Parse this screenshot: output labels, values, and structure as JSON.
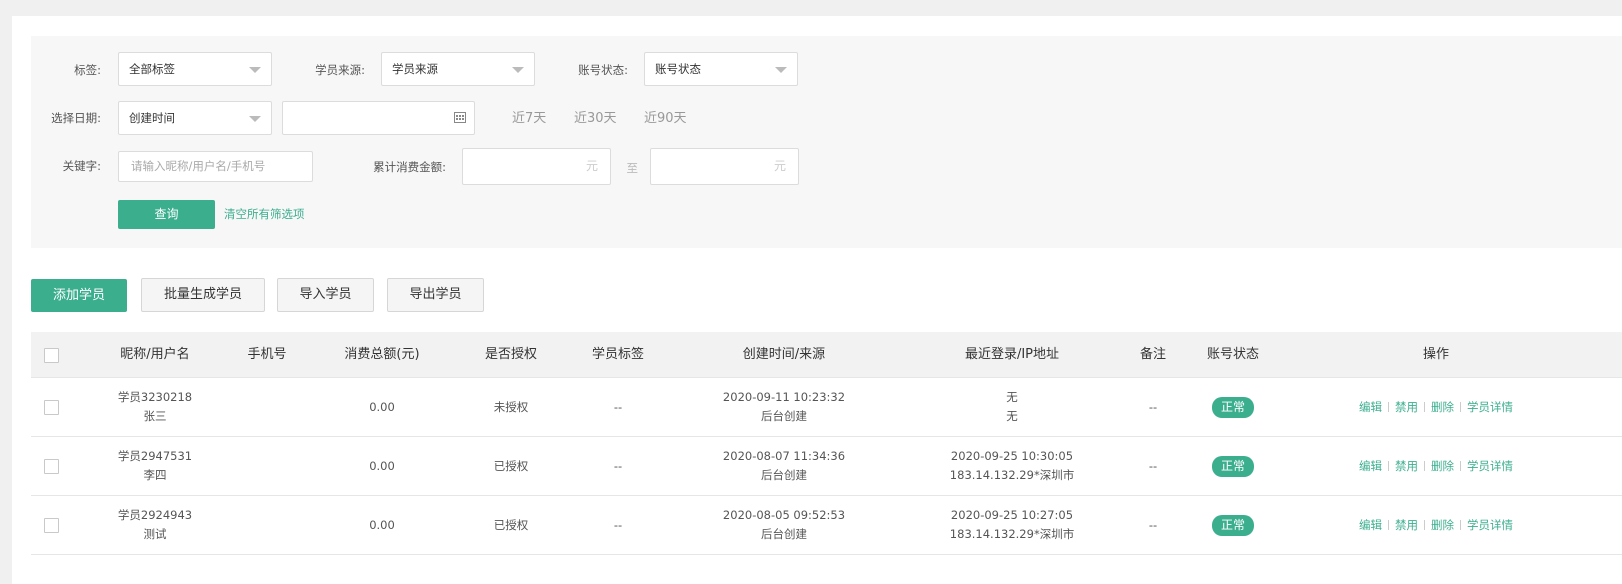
{
  "filters": {
    "tag_label": "标签:",
    "tag_value": "全部标签",
    "source_label": "学员来源:",
    "source_value": "学员来源",
    "status_label": "账号状态:",
    "status_value": "账号状态",
    "date_label": "选择日期:",
    "date_type_value": "创建时间",
    "quick_7": "近7天",
    "quick_30": "近30天",
    "quick_90": "近90天",
    "keyword_label": "关键字:",
    "keyword_placeholder": "请输入昵称/用户名/手机号",
    "amount_label": "累计消费金额:",
    "amount_unit": "元",
    "amount_to": "至",
    "query_button": "查询",
    "clear_link": "清空所有筛选项"
  },
  "actions": {
    "add": "添加学员",
    "batch": "批量生成学员",
    "import": "导入学员",
    "export": "导出学员"
  },
  "table": {
    "headers": {
      "name": "昵称/用户名",
      "phone": "手机号",
      "amount": "消费总额(元)",
      "auth": "是否授权",
      "tag": "学员标签",
      "created": "创建时间/来源",
      "login": "最近登录/IP地址",
      "remark": "备注",
      "status": "账号状态",
      "ops": "操作"
    },
    "rows": [
      {
        "nickname": "学员3230218",
        "username": "张三",
        "phone": "",
        "amount": "0.00",
        "auth": "未授权",
        "tag": "--",
        "created_time": "2020-09-11 10:23:32",
        "created_source": "后台创建",
        "login_time": "无",
        "login_ip": "无",
        "remark": "--",
        "status": "正常"
      },
      {
        "nickname": "学员2947531",
        "username": "李四",
        "phone": "",
        "amount": "0.00",
        "auth": "已授权",
        "tag": "--",
        "created_time": "2020-08-07 11:34:36",
        "created_source": "后台创建",
        "login_time": "2020-09-25 10:30:05",
        "login_ip": "183.14.132.29*深圳市",
        "remark": "--",
        "status": "正常"
      },
      {
        "nickname": "学员2924943",
        "username": "测试",
        "phone": "",
        "amount": "0.00",
        "auth": "已授权",
        "tag": "--",
        "created_time": "2020-08-05 09:52:53",
        "created_source": "后台创建",
        "login_time": "2020-09-25 10:27:05",
        "login_ip": "183.14.132.29*深圳市",
        "remark": "--",
        "status": "正常"
      }
    ],
    "op_labels": {
      "edit": "编辑",
      "disable": "禁用",
      "delete": "删除",
      "detail": "学员详情"
    }
  },
  "colors": {
    "primary": "#3bae8e",
    "filter_bg": "#f7f7f7",
    "header_bg": "#f2f2f2"
  }
}
